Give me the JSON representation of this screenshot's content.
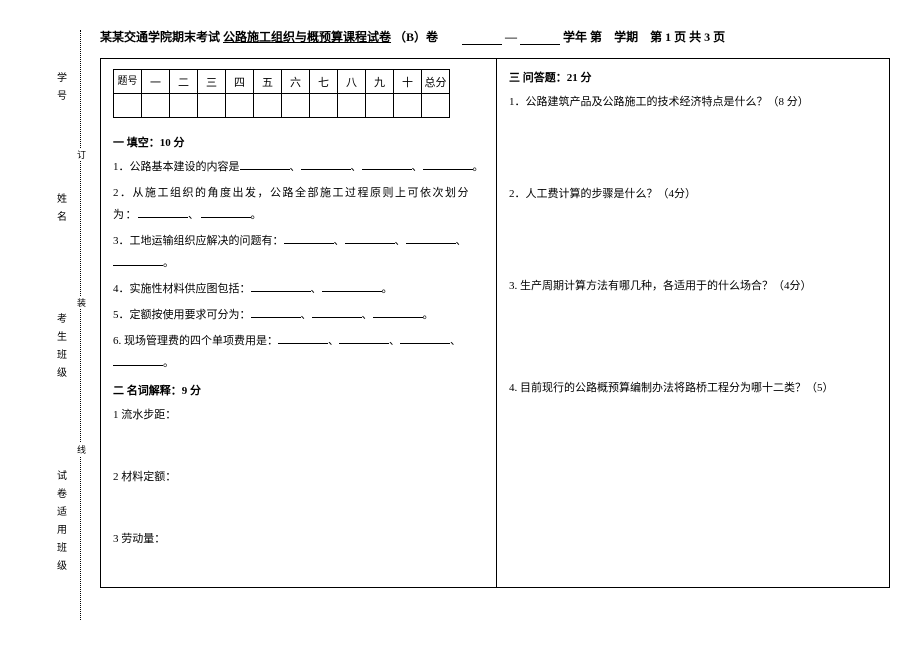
{
  "sidebar": {
    "labels": [
      "学号",
      "姓名",
      "考生班级",
      "试卷适用班级"
    ],
    "marks": [
      "订",
      "装",
      "线"
    ]
  },
  "header": {
    "school": "某某交通学院期末考试",
    "course": "公路施工组织与概预算课程试卷",
    "paper": "（B）卷",
    "mid_dash": "—",
    "year_label": "学年 第",
    "term_label": "学期",
    "page_prefix": "第",
    "page_num": "1",
    "page_mid": "页    共",
    "page_total": "3",
    "page_suffix": "页"
  },
  "score_table": {
    "row_label": "题号",
    "cols": [
      "一",
      "二",
      "三",
      "四",
      "五",
      "六",
      "七",
      "八",
      "九",
      "十",
      "总分"
    ]
  },
  "left": {
    "sec1_title": "一 填空：10 分",
    "q1_pre": "1．公路基本建设的内容是",
    "q1_sep": "、",
    "q1_end": "。",
    "q2_pre": "2．从施工组织的角度出发，公路全部施工过程原则上可依次划分为：",
    "q2_sep": "、",
    "q2_end": "。",
    "q3_pre": "3．工地运输组织应解决的问题有：",
    "q3_sep": "、",
    "q3_end": "。",
    "q4_pre": "4．实施性材料供应图包括：",
    "q4_sep": "、",
    "q4_end": "。",
    "q5_pre": "5．定额按使用要求可分为：",
    "q5_sep": "、",
    "q5_end": "。",
    "q6_pre": "6. 现场管理费的四个单项费用是：",
    "q6_sep": "、",
    "q6_end": "。",
    "sec2_title": "二 名词解释：9 分",
    "term1": "1 流水步距：",
    "term2": "2 材料定额：",
    "term3": "3 劳动量："
  },
  "right": {
    "sec3_title": "三 问答题：21 分",
    "q1": "1．公路建筑产品及公路施工的技术经济特点是什么？（8 分）",
    "q2": "2．人工费计算的步骤是什么？（4分）",
    "q3": "3. 生产周期计算方法有哪几种，各适用于的什么场合？（4分）",
    "q4": "4. 目前现行的公路概预算编制办法将路桥工程分为哪十二类？（5）"
  }
}
